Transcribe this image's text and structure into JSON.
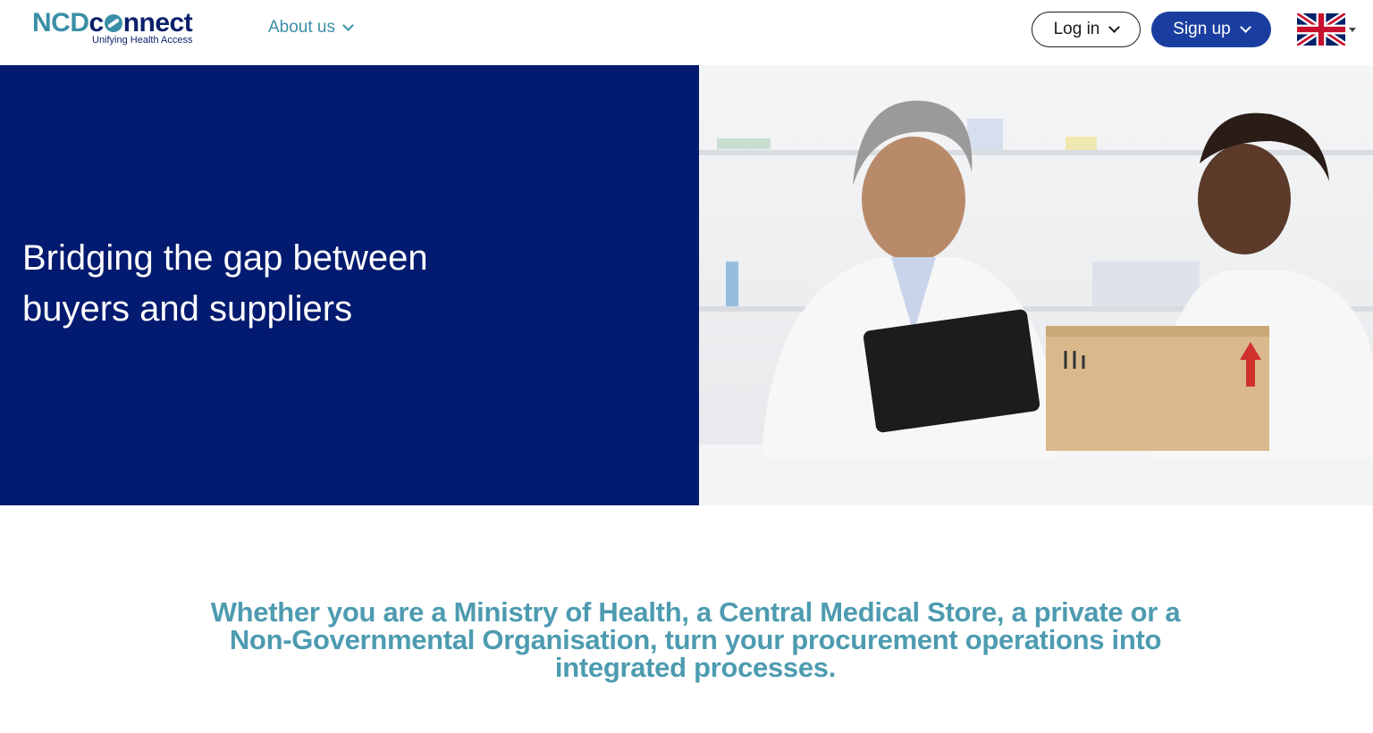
{
  "header": {
    "logo": {
      "brand_part1": "NCD",
      "brand_part2": "connect",
      "brand_dot_letter": "o",
      "tagline": "Unifying Health Access"
    },
    "nav": {
      "about_label": "About us"
    },
    "login_label": "Log in",
    "signup_label": "Sign up",
    "language": {
      "flag": "uk-flag-icon"
    }
  },
  "hero": {
    "title": "Bridging the gap between buyers and suppliers",
    "image": "pharmacists-with-tablet-and-box-photo"
  },
  "intro": {
    "text": "Whether you are a Ministry of Health, a Central Medical Store, a private or a Non-Governmental Organisation, turn your procurement operations into integrated processes."
  },
  "colors": {
    "hero_bg": "#021a6f",
    "accent_teal": "#3a8fa6",
    "signup_bg": "#1a3ea0",
    "tagline": "#4d9bb0"
  }
}
